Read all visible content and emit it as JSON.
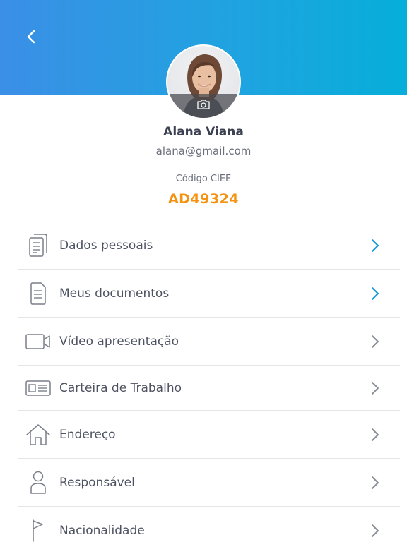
{
  "header": {
    "back_icon": "chevron-left-icon",
    "gradient": [
      "#3b8fe6",
      "#06aed9"
    ]
  },
  "profile": {
    "name": "Alana Viana",
    "email": "alana@gmail.com",
    "code_label": "Código CIEE",
    "code_value": "AD49324",
    "code_color": "#f5920f",
    "camera_icon": "camera-icon"
  },
  "menu": {
    "items": [
      {
        "label": "Dados pessoais",
        "icon": "documents-icon",
        "chevron_color": "#1e9ad6"
      },
      {
        "label": "Meus documentos",
        "icon": "document-icon",
        "chevron_color": "#1e9ad6"
      },
      {
        "label": "Vídeo apresentação",
        "icon": "video-camera-icon",
        "chevron_color": "#8a8e98"
      },
      {
        "label": "Carteira de Trabalho",
        "icon": "id-card-icon",
        "chevron_color": "#8a8e98"
      },
      {
        "label": "Endereço",
        "icon": "home-icon",
        "chevron_color": "#8a8e98"
      },
      {
        "label": "Responsável",
        "icon": "person-icon",
        "chevron_color": "#8a8e98"
      },
      {
        "label": "Nacionalidade",
        "icon": "flag-icon",
        "chevron_color": "#8a8e98"
      }
    ]
  }
}
